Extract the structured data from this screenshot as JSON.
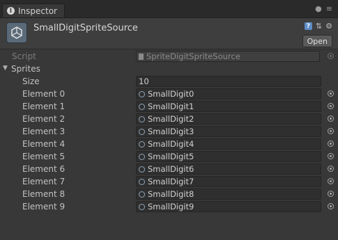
{
  "window": {
    "tab_label": "Inspector"
  },
  "header": {
    "component_name": "SmallDigitSpriteSource",
    "open_label": "Open"
  },
  "script_field": {
    "label": "Script",
    "value": "SpriteDigitSpriteSource"
  },
  "sprites": {
    "label": "Sprites",
    "size_label": "Size",
    "size_value": "10",
    "elements": [
      {
        "label": "Element 0",
        "value": "SmallDigit0"
      },
      {
        "label": "Element 1",
        "value": "SmallDigit1"
      },
      {
        "label": "Element 2",
        "value": "SmallDigit2"
      },
      {
        "label": "Element 3",
        "value": "SmallDigit3"
      },
      {
        "label": "Element 4",
        "value": "SmallDigit4"
      },
      {
        "label": "Element 5",
        "value": "SmallDigit5"
      },
      {
        "label": "Element 6",
        "value": "SmallDigit6"
      },
      {
        "label": "Element 7",
        "value": "SmallDigit7"
      },
      {
        "label": "Element 8",
        "value": "SmallDigit8"
      },
      {
        "label": "Element 9",
        "value": "SmallDigit9"
      }
    ]
  },
  "icons": {
    "tab": "info-icon",
    "lock": "lock-icon",
    "menu": "menu-icon",
    "component": "unity-script-icon",
    "help": "help-icon",
    "presets": "presets-icon",
    "settings": "gear-icon"
  },
  "colors": {
    "background": "#383838",
    "field": "#2f2f2f",
    "accent": "#5e8dc6"
  }
}
